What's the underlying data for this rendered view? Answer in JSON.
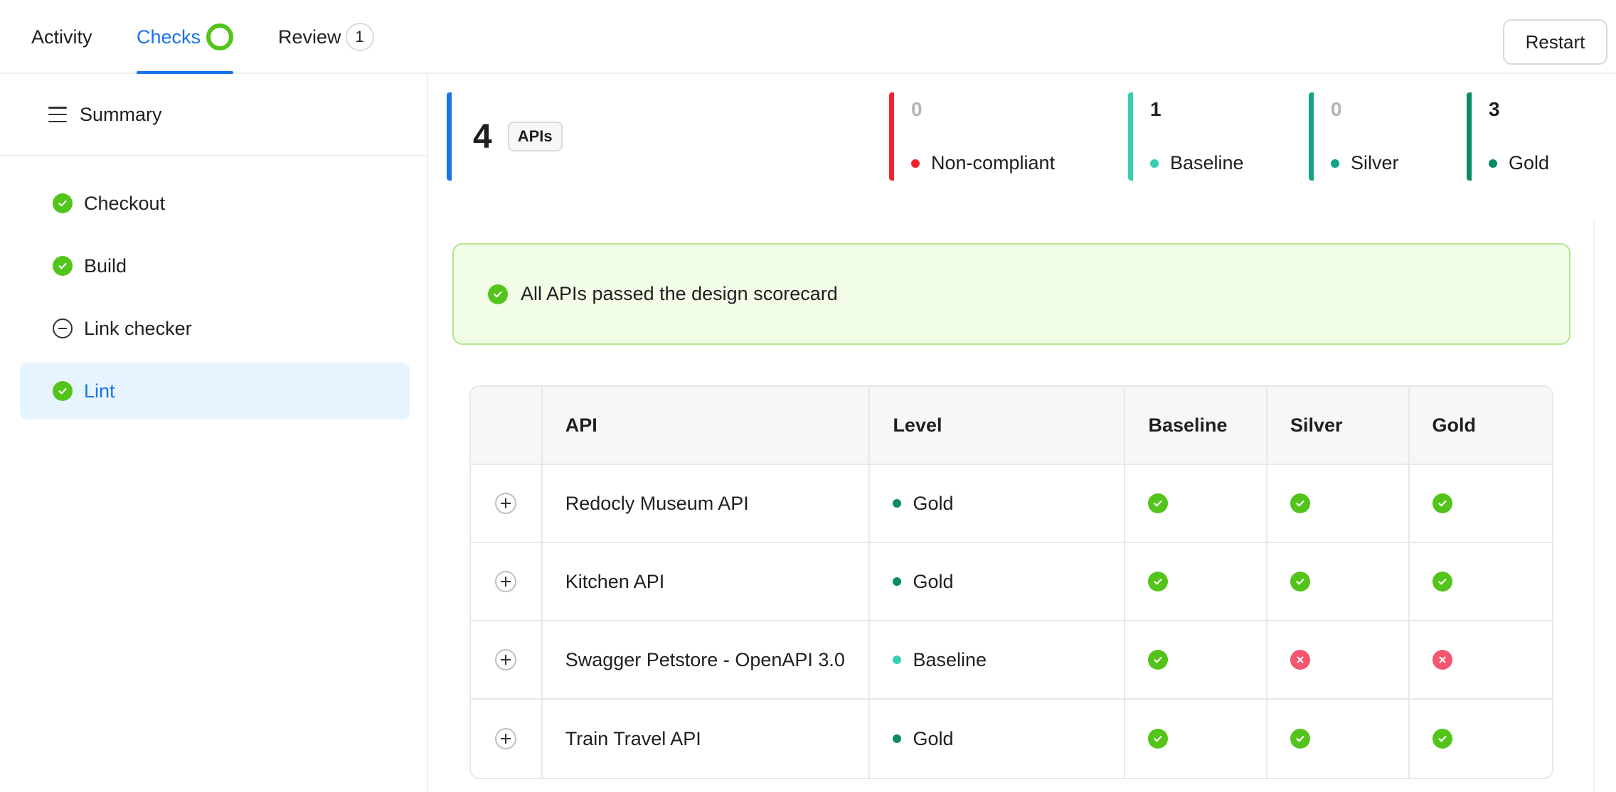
{
  "tabs": {
    "activity": "Activity",
    "checks": "Checks",
    "review": "Review",
    "review_count": "1"
  },
  "restart_label": "Restart",
  "sidebar": {
    "summary": "Summary",
    "items": [
      {
        "label": "Checkout",
        "status": "passed"
      },
      {
        "label": "Build",
        "status": "passed"
      },
      {
        "label": "Link checker",
        "status": "skipped"
      },
      {
        "label": "Lint",
        "status": "passed"
      }
    ]
  },
  "stats": {
    "total": "4",
    "total_label": "APIs",
    "noncompliant": {
      "count": "0",
      "label": "Non-compliant",
      "color": "#f5222d"
    },
    "baseline": {
      "count": "1",
      "label": "Baseline",
      "color": "#36cfb0"
    },
    "silver": {
      "count": "0",
      "label": "Silver",
      "color": "#13a389"
    },
    "gold": {
      "count": "3",
      "label": "Gold",
      "color": "#0b8a66"
    }
  },
  "banner": "All APIs passed the design scorecard",
  "table": {
    "headers": {
      "api": "API",
      "level": "Level",
      "baseline": "Baseline",
      "silver": "Silver",
      "gold": "Gold"
    },
    "rows": [
      {
        "api": "Redocly Museum API",
        "level": "Gold",
        "baseline": "pass",
        "silver": "pass",
        "gold": "pass"
      },
      {
        "api": "Kitchen API",
        "level": "Gold",
        "baseline": "pass",
        "silver": "pass",
        "gold": "pass"
      },
      {
        "api": "Swagger Petstore - OpenAPI 3.0",
        "level": "Baseline",
        "baseline": "pass",
        "silver": "fail",
        "gold": "fail"
      },
      {
        "api": "Train Travel API",
        "level": "Gold",
        "baseline": "pass",
        "silver": "pass",
        "gold": "pass"
      }
    ]
  },
  "colors": {
    "accent": "#1a73e8",
    "success": "#52c41a",
    "error": "#f4566f"
  }
}
